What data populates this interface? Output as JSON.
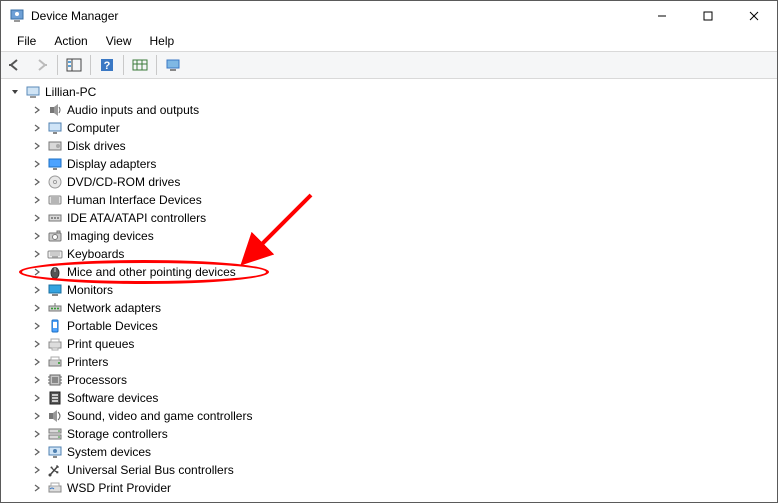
{
  "window": {
    "title": "Device Manager"
  },
  "menu": {
    "file": "File",
    "action": "Action",
    "view": "View",
    "help": "Help"
  },
  "tree": {
    "root": "Lillian-PC",
    "items": [
      {
        "label": "Audio inputs and outputs",
        "icon": "speaker"
      },
      {
        "label": "Computer",
        "icon": "monitor"
      },
      {
        "label": "Disk drives",
        "icon": "disk"
      },
      {
        "label": "Display adapters",
        "icon": "display"
      },
      {
        "label": "DVD/CD-ROM drives",
        "icon": "cd"
      },
      {
        "label": "Human Interface Devices",
        "icon": "hid"
      },
      {
        "label": "IDE ATA/ATAPI controllers",
        "icon": "ide"
      },
      {
        "label": "Imaging devices",
        "icon": "camera"
      },
      {
        "label": "Keyboards",
        "icon": "keyboard"
      },
      {
        "label": "Mice and other pointing devices",
        "icon": "mouse",
        "highlighted": true
      },
      {
        "label": "Monitors",
        "icon": "monitor2"
      },
      {
        "label": "Network adapters",
        "icon": "network"
      },
      {
        "label": "Portable Devices",
        "icon": "portable"
      },
      {
        "label": "Print queues",
        "icon": "printq"
      },
      {
        "label": "Printers",
        "icon": "printer"
      },
      {
        "label": "Processors",
        "icon": "cpu"
      },
      {
        "label": "Software devices",
        "icon": "software"
      },
      {
        "label": "Sound, video and game controllers",
        "icon": "sound"
      },
      {
        "label": "Storage controllers",
        "icon": "storage"
      },
      {
        "label": "System devices",
        "icon": "system"
      },
      {
        "label": "Universal Serial Bus controllers",
        "icon": "usb"
      },
      {
        "label": "WSD Print Provider",
        "icon": "wsd"
      }
    ]
  },
  "annotation": {
    "highlighted_index": 9
  }
}
